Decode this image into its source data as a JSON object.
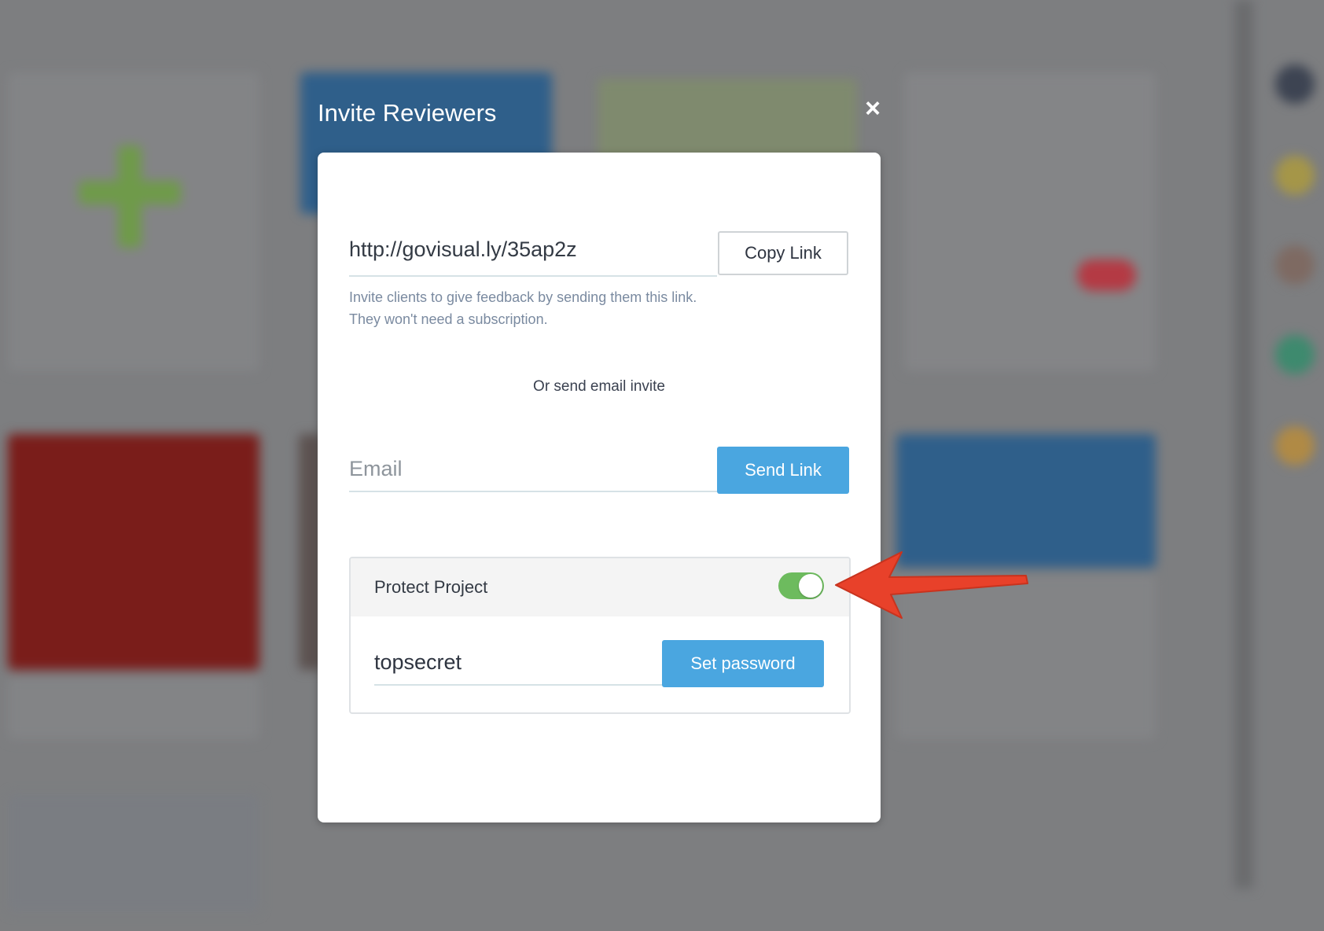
{
  "modal": {
    "title": "Invite Reviewers",
    "close_symbol": "×"
  },
  "share_link": {
    "url": "http://govisual.ly/35ap2z",
    "copy_label": "Copy Link",
    "hint_line1": "Invite clients to give feedback by sending them this link.",
    "hint_line2": "They won't need a subscription."
  },
  "email_invite": {
    "divider_text": "Or send email invite",
    "placeholder": "Email",
    "value": "",
    "send_label": "Send Link"
  },
  "protection": {
    "label": "Protect Project",
    "enabled": true,
    "password_value": "topsecret",
    "set_password_label": "Set password"
  },
  "colors": {
    "accent_blue": "#4aa6e0",
    "toggle_on": "#6dbb5e",
    "annotation_arrow": "#e8412a"
  },
  "icons": [
    "close-icon",
    "annotation-arrow-icon"
  ]
}
